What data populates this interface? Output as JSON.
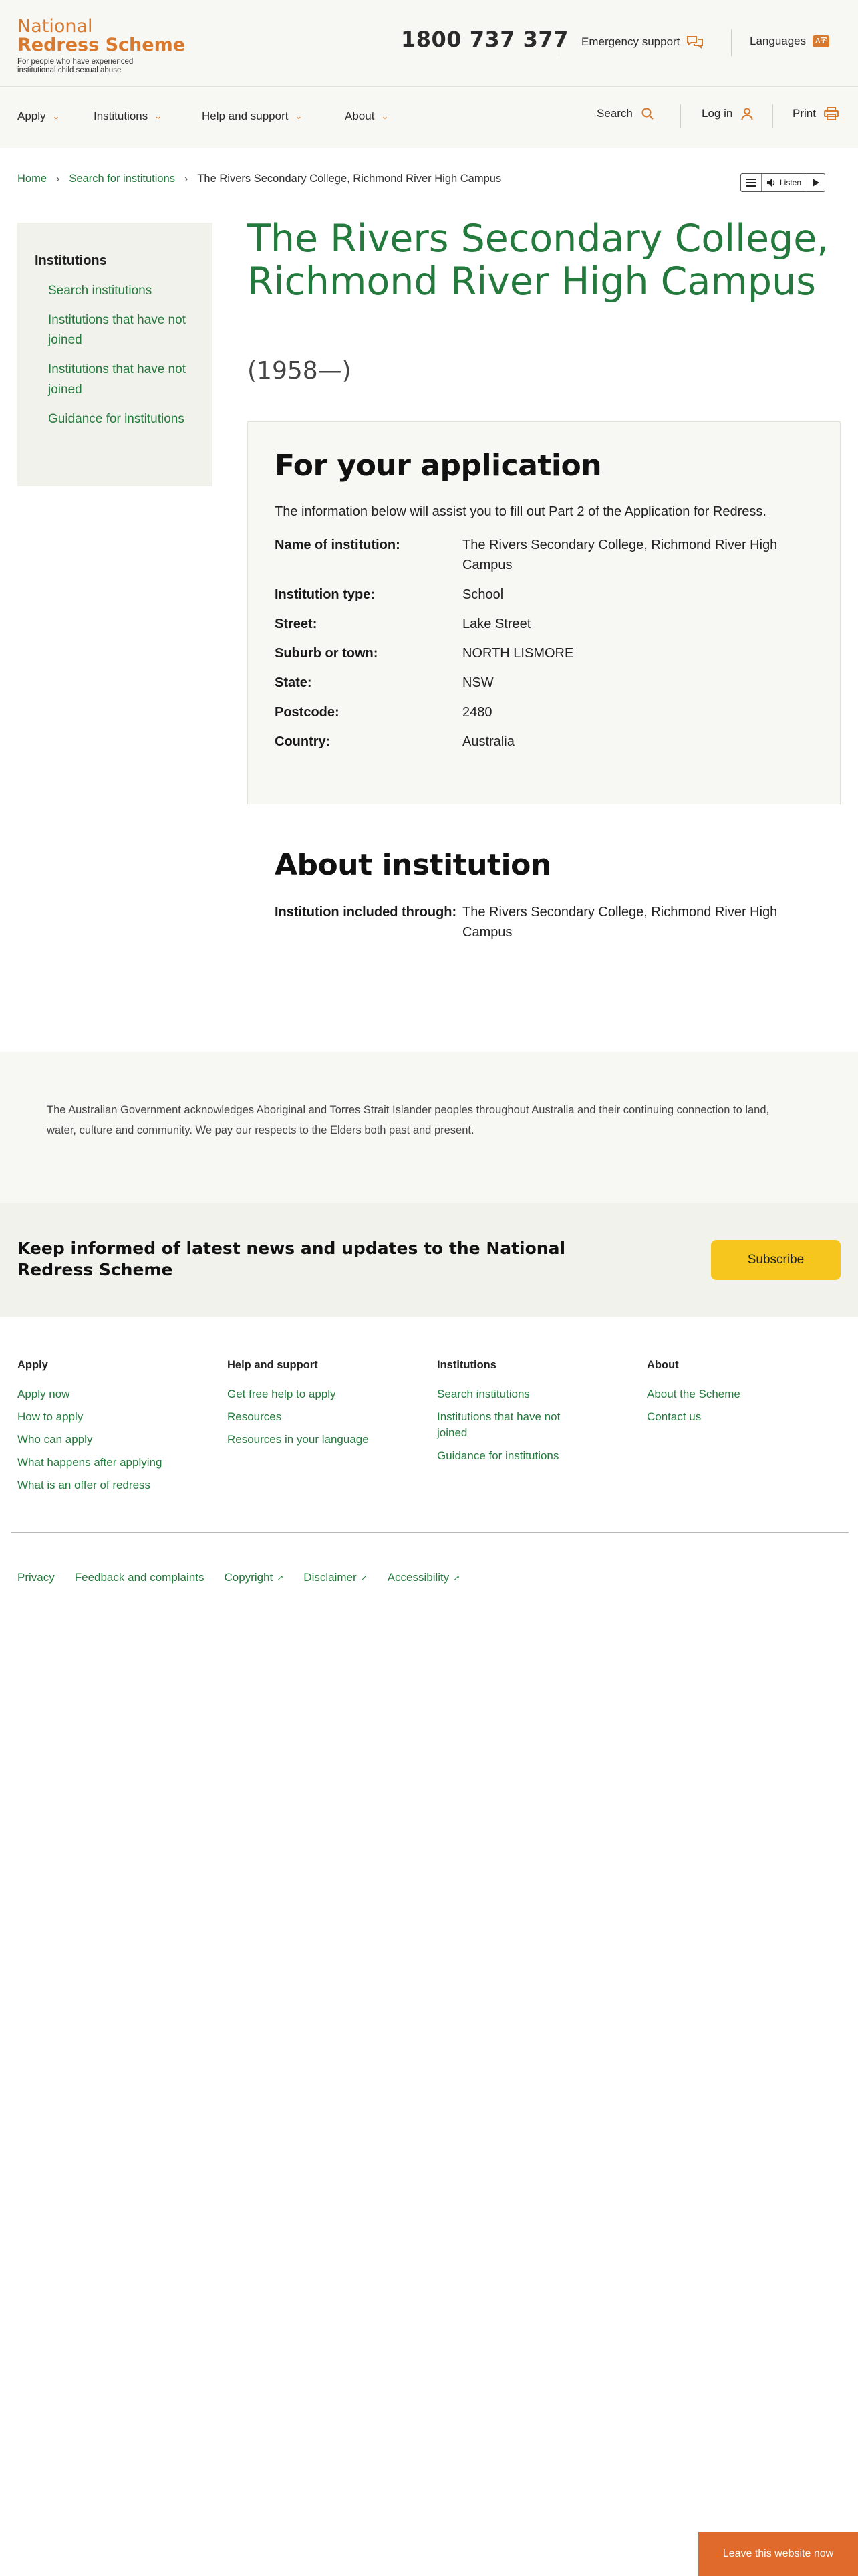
{
  "header": {
    "brand_line1": "National",
    "brand_line2": "Redress Scheme",
    "brand_tagline": "For people who have experienced institutional child sexual abuse",
    "phone": "1800 737 377",
    "emergency_label": "Emergency support",
    "languages_label": "Languages",
    "languages_badge": "A字"
  },
  "nav": {
    "items": [
      {
        "label": "Apply"
      },
      {
        "label": "Institutions"
      },
      {
        "label": "Help and support"
      },
      {
        "label": "About"
      }
    ],
    "search_label": "Search",
    "login_label": "Log in",
    "print_label": "Print"
  },
  "breadcrumb": {
    "home": "Home",
    "search": "Search for institutions",
    "current": "The Rivers Secondary College, Richmond River High Campus"
  },
  "listen": {
    "label": "Listen"
  },
  "sidebar": {
    "title": "Institutions",
    "items": [
      {
        "label": "Search institutions"
      },
      {
        "label": "Institutions that have not joined"
      },
      {
        "label": "Institutions that have not joined"
      },
      {
        "label": "Guidance for institutions"
      }
    ]
  },
  "page": {
    "title": "The Rivers Secondary College, Richmond River High Campus",
    "years": "(1958—)"
  },
  "application": {
    "heading": "For your application",
    "intro": "The information below will assist you to fill out Part 2 of the Application for Redress.",
    "details": [
      {
        "label": "Name of institution:",
        "value": "The Rivers Secondary College, Richmond River High Campus"
      },
      {
        "label": "Institution type:",
        "value": "School"
      },
      {
        "label": "Street:",
        "value": "Lake Street"
      },
      {
        "label": "Suburb or town:",
        "value": "NORTH LISMORE"
      },
      {
        "label": "State:",
        "value": "NSW"
      },
      {
        "label": "Postcode:",
        "value": "2480"
      },
      {
        "label": "Country:",
        "value": "Australia"
      }
    ]
  },
  "about": {
    "heading": "About institution",
    "included_label": "Institution included through:",
    "included_value": "The Rivers Secondary College, Richmond River High Campus"
  },
  "acknowledgement": "The Australian Government acknowledges Aboriginal and Torres Strait Islander peoples throughout Australia and their continuing connection to land, water, culture and community. We pay our respects to the Elders both past and present.",
  "subscribe": {
    "text": "Keep informed of latest news and updates to the National Redress Scheme",
    "button": "Subscribe"
  },
  "footer": {
    "columns": [
      {
        "title": "Apply",
        "links": [
          "Apply now",
          "How to apply",
          "Who can apply",
          "What happens after applying",
          "What is an offer of redress"
        ]
      },
      {
        "title": "Help and support",
        "links": [
          "Get free help to apply",
          "Resources",
          "Resources in your language"
        ]
      },
      {
        "title": "Institutions",
        "links": [
          "Search institutions",
          "Institutions that have not joined",
          "Guidance for institutions"
        ]
      },
      {
        "title": "About",
        "links": [
          "About the Scheme",
          "Contact us"
        ]
      }
    ],
    "legal": [
      "Privacy",
      "Feedback and complaints",
      "Copyright",
      "Disclaimer",
      "Accessibility"
    ]
  },
  "leave_button": "Leave this website now",
  "colors": {
    "brand_orange": "#d9792d",
    "link_green": "#247a3d",
    "subscribe_yellow": "#f6c61e",
    "leave_orange": "#df6a2c"
  }
}
